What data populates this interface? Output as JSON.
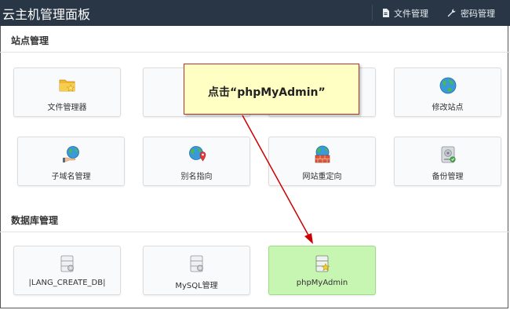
{
  "app_title": "云主机管理面板",
  "topbar": {
    "files_label": "文件管理",
    "password_label": "密码管理"
  },
  "sections": {
    "site": {
      "title": "站点管理"
    },
    "db": {
      "title": "数据库管理"
    }
  },
  "site_tiles": [
    {
      "label": "文件管理器",
      "icon": "folder-star-icon"
    },
    {
      "label": "",
      "icon": "hidden"
    },
    {
      "label": "",
      "icon": "hidden"
    },
    {
      "label": "修改站点",
      "icon": "globe-icon"
    },
    {
      "label": "子域名管理",
      "icon": "globe-hand-icon"
    },
    {
      "label": "别名指向",
      "icon": "globe-pin-icon"
    },
    {
      "label": "网站重定向",
      "icon": "globe-wall-icon"
    },
    {
      "label": "备份管理",
      "icon": "backup-drive-icon"
    }
  ],
  "db_tiles": [
    {
      "label": "|LANG_CREATE_DB|",
      "icon": "database-gear-icon"
    },
    {
      "label": "MySQL管理",
      "icon": "database-gear-icon"
    },
    {
      "label": "phpMyAdmin",
      "icon": "database-star-icon",
      "highlighted": true
    }
  ],
  "callout": {
    "text": "点击“phpMyAdmin”"
  },
  "colors": {
    "topbar": "#283645",
    "highlight": "#c7f5b2",
    "callout_bg": "#ffffc4",
    "arrow": "#cc0000"
  }
}
